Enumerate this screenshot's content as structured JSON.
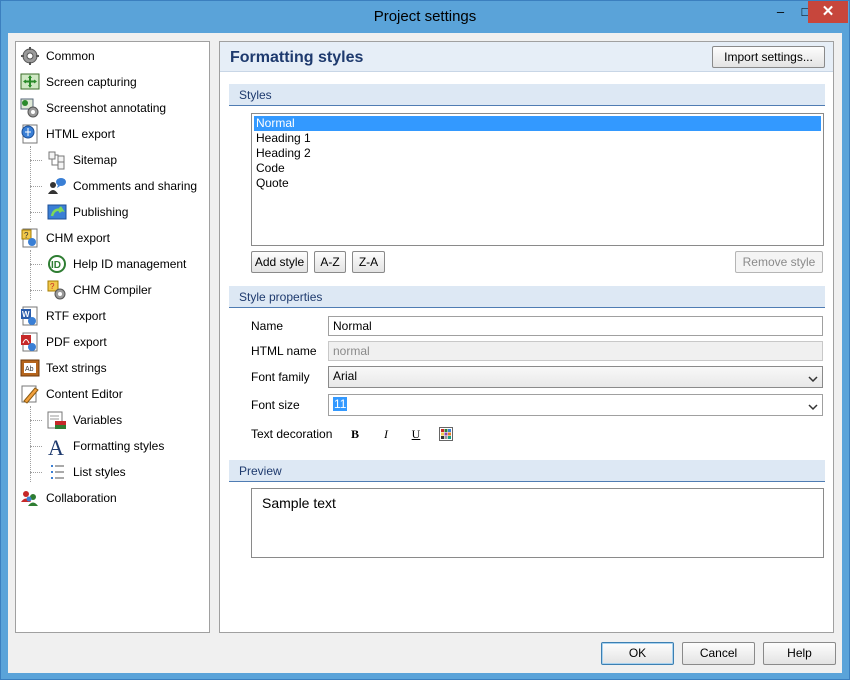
{
  "window": {
    "title": "Project settings",
    "controls": {
      "minimize": "–",
      "maximize": "□",
      "close": "✕"
    }
  },
  "tree": {
    "items": [
      {
        "label": "Common",
        "icon": "gear-icon"
      },
      {
        "label": "Screen capturing",
        "icon": "screen-capture-icon"
      },
      {
        "label": "Screenshot annotating",
        "icon": "annotate-gear-icon"
      },
      {
        "label": "HTML export",
        "icon": "html-export-icon"
      },
      {
        "label": "Sitemap",
        "icon": "sitemap-icon"
      },
      {
        "label": "Comments and sharing",
        "icon": "comments-icon"
      },
      {
        "label": "Publishing",
        "icon": "publishing-icon"
      },
      {
        "label": "CHM export",
        "icon": "chm-export-icon"
      },
      {
        "label": "Help ID management",
        "icon": "help-id-icon"
      },
      {
        "label": "CHM Compiler",
        "icon": "chm-compiler-icon"
      },
      {
        "label": "RTF export",
        "icon": "rtf-export-icon"
      },
      {
        "label": "PDF export",
        "icon": "pdf-export-icon"
      },
      {
        "label": "Text strings",
        "icon": "text-strings-icon"
      },
      {
        "label": "Content Editor",
        "icon": "content-editor-icon"
      },
      {
        "label": "Variables",
        "icon": "variables-icon"
      },
      {
        "label": "Formatting styles",
        "icon": "formatting-styles-icon"
      },
      {
        "label": "List styles",
        "icon": "list-styles-icon"
      },
      {
        "label": "Collaboration",
        "icon": "collaboration-icon"
      }
    ]
  },
  "panel": {
    "title": "Formatting styles",
    "import_button": "Import settings...",
    "styles_section": "Styles",
    "styles": [
      "Normal",
      "Heading 1",
      "Heading 2",
      "Code",
      "Quote"
    ],
    "selected_style": "Normal",
    "add_style": "Add style",
    "sort_az": "A-Z",
    "sort_za": "Z-A",
    "remove_style": "Remove style",
    "properties_section": "Style properties",
    "name_label": "Name",
    "name_value": "Normal",
    "html_name_label": "HTML name",
    "html_name_value": "normal",
    "font_family_label": "Font family",
    "font_family_value": "Arial",
    "font_size_label": "Font size",
    "font_size_value": "11",
    "text_decoration_label": "Text decoration",
    "bold": "B",
    "italic": "I",
    "underline": "U",
    "preview_section": "Preview",
    "preview_text": "Sample text"
  },
  "footer": {
    "ok": "OK",
    "cancel": "Cancel",
    "help": "Help"
  },
  "colors": {
    "titlebar": "#5aa3d9",
    "close_button": "#c7463c",
    "section_header": "#dde8f4",
    "selection": "#3399ff",
    "heading_text": "#1e3a6e"
  }
}
